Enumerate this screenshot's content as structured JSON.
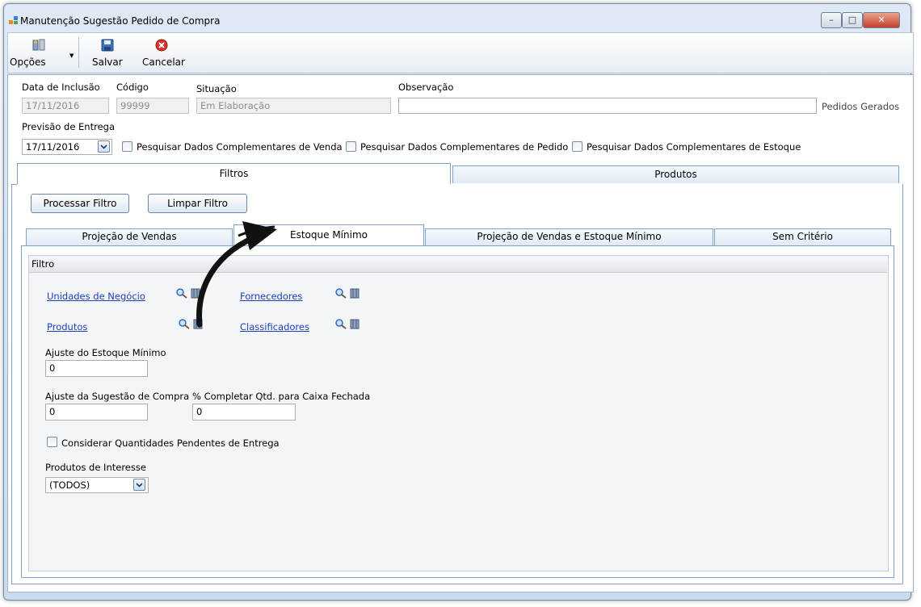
{
  "window": {
    "title": "Manutenção Sugestão Pedido de Compra",
    "controls": [
      "–",
      "□",
      "✕"
    ]
  },
  "toolbar": {
    "options_label": "Opções",
    "save_label": "Salvar",
    "cancel_label": "Cancelar"
  },
  "header": {
    "data_inclusao_label": "Data de Inclusão",
    "data_inclusao_value": "17/11/2016",
    "codigo_label": "Código",
    "codigo_value": "99999",
    "situacao_label": "Situação",
    "situacao_value": "Em Elaboração",
    "observacao_label": "Observação",
    "observacao_value": "",
    "pedidos_gerados": "Pedidos Gerados",
    "previsao_label": "Previsão de Entrega",
    "previsao_value": "17/11/2016",
    "chk_venda": "Pesquisar Dados Complementares de Venda",
    "chk_pedido": "Pesquisar Dados Complementares de Pedido",
    "chk_estoque": "Pesquisar Dados Complementares de Estoque"
  },
  "main_tabs": {
    "filtros": "Filtros",
    "produtos": "Produtos"
  },
  "buttons": {
    "processar": "Processar Filtro",
    "limpar": "Limpar Filtro"
  },
  "sub_tabs": {
    "projecao": "Projeção de Vendas",
    "estoque": "Estoque Mínimo",
    "projecao_estoque": "Projeção de Vendas e Estoque Mínimo",
    "sem_criterio": "Sem Critério"
  },
  "filtro": {
    "group_label": "Filtro",
    "unidades": "Unidades de Negócio",
    "fornecedores": "Fornecedores",
    "produtos": "Produtos",
    "classificadores": "Classificadores",
    "ajuste_estoque_label": "Ajuste do Estoque Mínimo",
    "ajuste_estoque_value": "0",
    "ajuste_sugestao_label": "Ajuste da Sugestão de Compra",
    "ajuste_sugestao_value": "0",
    "completar_label": "% Completar Qtd. para Caixa Fechada",
    "completar_value": "0",
    "considerar_label": "Considerar Quantidades Pendentes de Entrega",
    "interesse_label": "Produtos de Interesse",
    "interesse_value": "(TODOS)"
  }
}
